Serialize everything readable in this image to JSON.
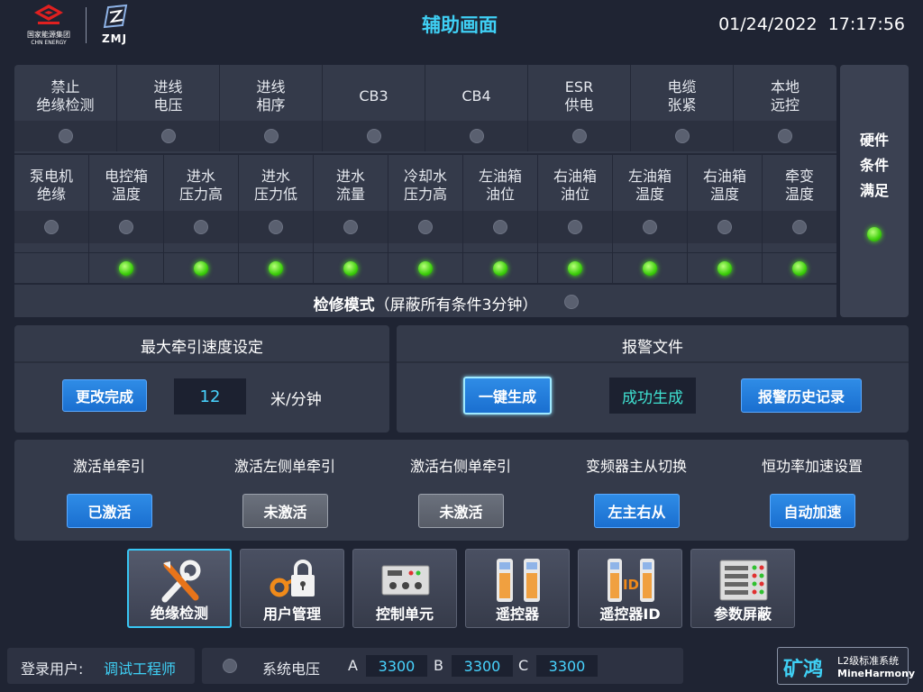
{
  "header": {
    "logo1_text": "国家能源集团",
    "logo1_sub": "CHN ENERGY",
    "logo2_text": "ZMJ",
    "title": "辅助画面",
    "date": "01/24/2022",
    "time": "17:17:56"
  },
  "conditions_row1": [
    {
      "label": "禁止\n绝缘检测",
      "state": "off"
    },
    {
      "label": "进线\n电压",
      "state": "off"
    },
    {
      "label": "进线\n相序",
      "state": "off"
    },
    {
      "label": "CB3",
      "state": "off"
    },
    {
      "label": "CB4",
      "state": "off"
    },
    {
      "label": "ESR\n供电",
      "state": "off"
    },
    {
      "label": "电缆\n张紧",
      "state": "off"
    },
    {
      "label": "本地\n远控",
      "state": "off"
    }
  ],
  "conditions_row2": [
    {
      "label": "泵电机\n绝缘",
      "state1": "off",
      "state2": "none"
    },
    {
      "label": "电控箱\n温度",
      "state1": "off",
      "state2": "on"
    },
    {
      "label": "进水\n压力高",
      "state1": "off",
      "state2": "on"
    },
    {
      "label": "进水\n压力低",
      "state1": "off",
      "state2": "on"
    },
    {
      "label": "进水\n流量",
      "state1": "off",
      "state2": "on"
    },
    {
      "label": "冷却水\n压力高",
      "state1": "off",
      "state2": "on"
    },
    {
      "label": "左油箱\n油位",
      "state1": "off",
      "state2": "on"
    },
    {
      "label": "右油箱\n油位",
      "state1": "off",
      "state2": "on"
    },
    {
      "label": "左油箱\n温度",
      "state1": "off",
      "state2": "on"
    },
    {
      "label": "右油箱\n温度",
      "state1": "off",
      "state2": "on"
    },
    {
      "label": "牵变\n温度",
      "state1": "off",
      "state2": "on"
    }
  ],
  "maintenance": {
    "label_bold": "检修模式",
    "label_rest": "（屏蔽所有条件3分钟）",
    "state": "off"
  },
  "hardware": {
    "label": "硬件\n条件\n满足",
    "state": "on"
  },
  "speed": {
    "title": "最大牵引速度设定",
    "button": "更改完成",
    "value": "12",
    "unit": "米/分钟"
  },
  "alarm": {
    "title": "报警文件",
    "generate_button": "一键生成",
    "status": "成功生成",
    "history_button": "报警历史记录"
  },
  "activation": [
    {
      "label": "激活单牵引",
      "button": "已激活",
      "style": "blue"
    },
    {
      "label": "激活左侧单牵引",
      "button": "未激活",
      "style": "gray"
    },
    {
      "label": "激活右侧单牵引",
      "button": "未激活",
      "style": "gray"
    },
    {
      "label": "变频器主从切换",
      "button": "左主右从",
      "style": "blue"
    },
    {
      "label": "恒功率加速设置",
      "button": "自动加速",
      "style": "blue"
    }
  ],
  "nav": [
    {
      "label": "绝缘检测",
      "icon": "tools-icon",
      "selected": true
    },
    {
      "label": "用户管理",
      "icon": "key-lock-icon",
      "selected": false
    },
    {
      "label": "控制单元",
      "icon": "control-unit-icon",
      "selected": false
    },
    {
      "label": "遥控器",
      "icon": "remote-control-icon",
      "selected": false
    },
    {
      "label": "遥控器ID",
      "icon": "remote-id-icon",
      "selected": false
    },
    {
      "label": "参数屏蔽",
      "icon": "parameter-panel-icon",
      "selected": false
    }
  ],
  "footer": {
    "login_label": "登录用户:",
    "login_user": "调试工程师",
    "voltage_label": "系统电压",
    "phase_a": "A",
    "value_a": "3300",
    "phase_b": "B",
    "value_b": "3300",
    "phase_c": "C",
    "value_c": "3300",
    "voltage_state": "off"
  },
  "brand": {
    "big": "矿鸿",
    "line1": "L2级标准系统",
    "line2": "MineHarmony"
  },
  "colors": {
    "accent": "#3fd0f5",
    "led_on": "#3ecf0d",
    "led_off": "#5a6070",
    "button_blue": "#1a6fd0",
    "button_gray": "#575c67",
    "value_text": "#48d4ff"
  }
}
